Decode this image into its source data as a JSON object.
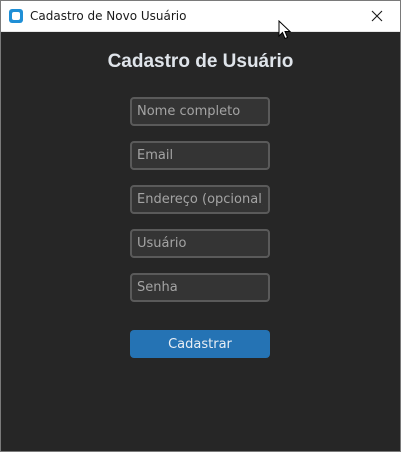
{
  "window": {
    "title": "Cadastro de Novo Usuário"
  },
  "form": {
    "heading": "Cadastro de Usuário",
    "fields": [
      {
        "name": "nome",
        "placeholder": "Nome completo",
        "value": ""
      },
      {
        "name": "email",
        "placeholder": "Email",
        "value": ""
      },
      {
        "name": "endereco",
        "placeholder": "Endereço (opcional)",
        "value": ""
      },
      {
        "name": "usuario",
        "placeholder": "Usuário",
        "value": ""
      },
      {
        "name": "senha",
        "placeholder": "Senha",
        "value": ""
      }
    ],
    "submit_label": "Cadastrar"
  },
  "colors": {
    "background": "#262626",
    "field_bg": "#343434",
    "field_border": "#5a5a5a",
    "button": "#2573b4",
    "heading": "#dfe4ea",
    "app_icon": "#1f8fd6"
  },
  "icons": {
    "app": "app-icon",
    "close": "close-icon",
    "cursor": "mouse-cursor-icon"
  }
}
